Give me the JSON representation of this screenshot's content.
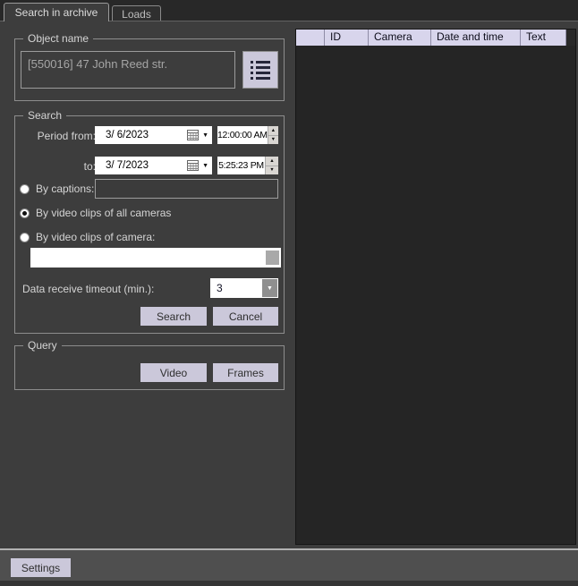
{
  "colors": {
    "panel": "#3d3d3d",
    "tab_strip": "#282828",
    "table_bg": "#252525",
    "table_header_bg": "#d8d5ec",
    "button_bg": "#cbc8da",
    "footer_bg": "#4f4f4f"
  },
  "tabs": [
    {
      "label": "Search in archive",
      "selected": true
    },
    {
      "label": "Loads",
      "selected": false
    }
  ],
  "object_group": {
    "legend": "Object name",
    "value": "[550016] 47 John Reed str."
  },
  "search_group": {
    "legend": "Search",
    "period_from_label": "Period from:",
    "to_label": "to:",
    "date_from": "3/ 6/2023",
    "time_from": "12:00:00 AM",
    "date_to": "3/ 7/2023",
    "time_to": "5:25:23 PM",
    "by_captions_label": "By captions:",
    "captions_value": "",
    "by_all_cameras_label": "By video clips of all cameras",
    "by_camera_label": "By video clips of camera:",
    "camera_value": "",
    "selected_option": "by_video_clips_of_all_cameras",
    "timeout_label": "Data receive timeout (min.):",
    "timeout_value": "3",
    "search_button": "Search",
    "cancel_button": "Cancel"
  },
  "query_group": {
    "legend": "Query",
    "video_button": "Video",
    "frames_button": "Frames"
  },
  "table": {
    "columns": [
      "",
      "ID",
      "Camera",
      "Date and time",
      "Text"
    ],
    "rows": []
  },
  "footer": {
    "settings_button": "Settings"
  },
  "icons": {
    "dropdown_arrow": "▼",
    "spin_up": "▲",
    "spin_down": "▼"
  }
}
